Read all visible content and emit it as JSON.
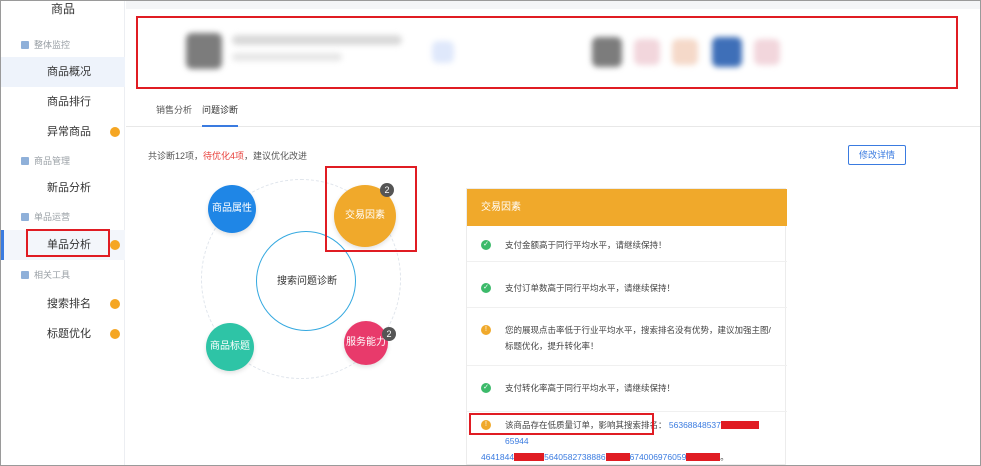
{
  "sidebar": {
    "top_label": "商品",
    "groups": [
      {
        "label": "整体监控",
        "items": [
          {
            "label": "商品概况",
            "dot": false
          },
          {
            "label": "商品排行",
            "dot": false
          },
          {
            "label": "异常商品",
            "dot": true
          }
        ]
      },
      {
        "label": "商品管理",
        "items": [
          {
            "label": "新品分析",
            "dot": false
          }
        ]
      },
      {
        "label": "单品运营",
        "items": [
          {
            "label": "单品分析",
            "dot": true
          }
        ]
      },
      {
        "label": "相关工具",
        "items": [
          {
            "label": "搜索排名",
            "dot": true
          },
          {
            "label": "标题优化",
            "dot": true
          }
        ]
      }
    ]
  },
  "tabs": [
    {
      "label": "销售分析",
      "active": false
    },
    {
      "label": "问题诊断",
      "active": true
    }
  ],
  "diagnosis": {
    "summary_prefix": "共诊断12项，",
    "summary_warn": "待优化4项",
    "summary_suffix": "，建议优化改进",
    "detail_button": "修改详情"
  },
  "wheel": {
    "center": "搜索问题诊断",
    "nodes": [
      {
        "label": "商品属性",
        "color": "#1f86e6",
        "badge": ""
      },
      {
        "label": "交易因素",
        "color": "#f0a92b",
        "badge": "2"
      },
      {
        "label": "商品标题",
        "color": "#2ec4a6",
        "badge": ""
      },
      {
        "label": "服务能力",
        "color": "#e83a6b",
        "badge": "2"
      }
    ]
  },
  "factor_panel": {
    "title": "交易因素",
    "rows": [
      {
        "status": "ok",
        "text": "支付金额高于同行平均水平，请继续保持！"
      },
      {
        "status": "ok",
        "text": "支付订单数高于同行平均水平，请继续保持！"
      },
      {
        "status": "warn",
        "text": "您的展现点击率低于行业平均水平，搜索排名没有优势，建议加强主图/标题优化，提升转化率！"
      },
      {
        "status": "ok",
        "text": "支付转化率高于同行平均水平，请继续保持！"
      },
      {
        "status": "warn",
        "text": "该商品存在低质量订单，影响其搜索排名：",
        "order_line1": "56368848537",
        "order_line1_tail": "65944",
        "order_line2_a": "4641844",
        "order_line2_b": "5640582738886",
        "order_line2_c": "674006976059",
        "order_line2_end": "。"
      }
    ]
  },
  "colors": {
    "accent": "#3a7be0",
    "warning_dot": "#f5a623",
    "highlight_box": "#e01c23",
    "panel_header": "#f0a92b"
  }
}
